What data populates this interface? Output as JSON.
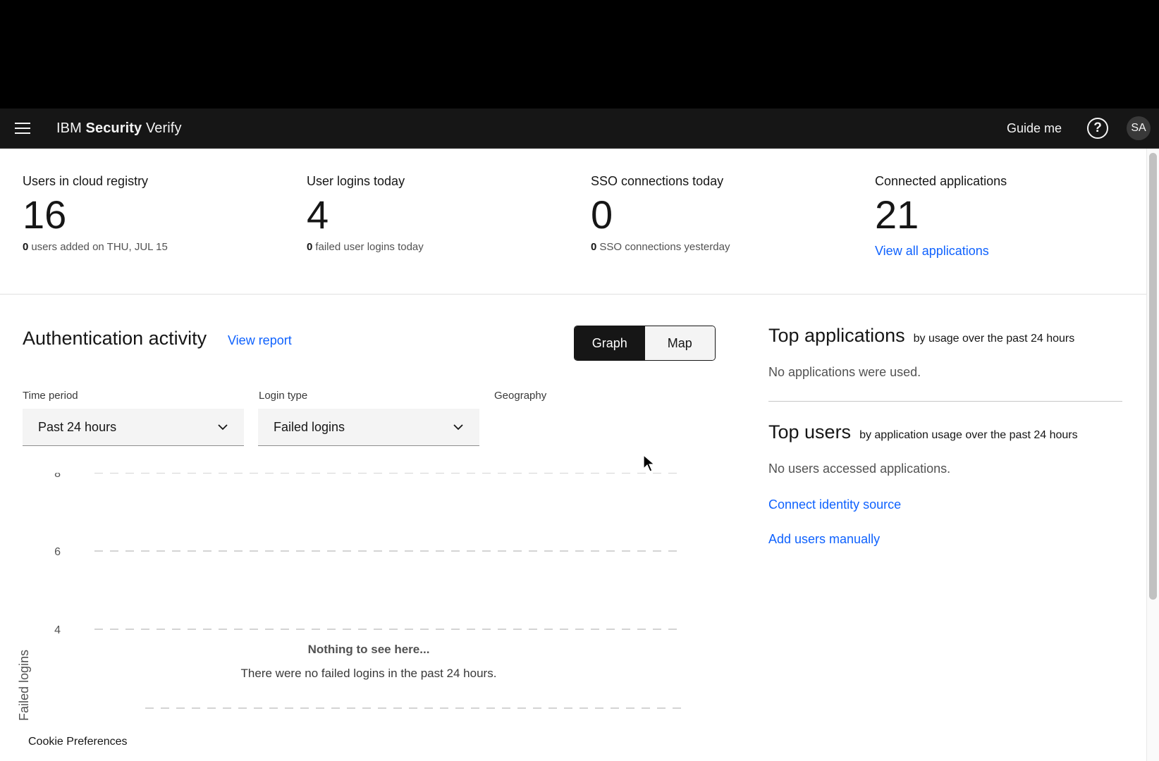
{
  "app": {
    "brand_prefix": "IBM",
    "brand_bold": "Security",
    "brand_suffix": "Verify",
    "guide_me": "Guide me",
    "help_symbol": "?",
    "avatar_initials": "SA"
  },
  "stats": [
    {
      "label": "Users in cloud registry",
      "value": "16",
      "sub_count": "0",
      "sub_text": "users added on THU, JUL 15"
    },
    {
      "label": "User logins today",
      "value": "4",
      "sub_count": "0",
      "sub_text": "failed user logins today"
    },
    {
      "label": "SSO connections today",
      "value": "0",
      "sub_count": "0",
      "sub_text": "SSO connections yesterday"
    },
    {
      "label": "Connected applications",
      "value": "21",
      "link": "View all applications"
    }
  ],
  "auth": {
    "title": "Authentication activity",
    "view_report": "View report",
    "view_toggle": [
      "Graph",
      "Map"
    ],
    "selected_view": "Graph",
    "filters": {
      "time_period": {
        "label": "Time period",
        "value": "Past 24 hours"
      },
      "login_type": {
        "label": "Login type",
        "value": "Failed logins"
      },
      "geography": {
        "label": "Geography"
      }
    },
    "empty_title": "Nothing to see here...",
    "empty_message": "There were no failed logins in the past 24 hours."
  },
  "chart_data": {
    "type": "line",
    "ylabel": "Failed logins",
    "yticks": [
      "8",
      "6",
      "4"
    ],
    "series": []
  },
  "side": {
    "top_apps_title": "Top applications",
    "top_apps_sub": "by usage over the past 24 hours",
    "top_apps_empty": "No applications were used.",
    "top_users_title": "Top users",
    "top_users_sub": "by application usage over the past 24 hours",
    "top_users_empty": "No users accessed applications.",
    "connect_identity": "Connect identity source",
    "add_users": "Add users manually"
  },
  "footer": {
    "cookie": "Cookie Preferences"
  },
  "colors": {
    "link": "#0f62fe",
    "header_bg": "#161616",
    "ui_bg": "#f4f4f4"
  },
  "icons": [
    "menu-icon",
    "help-icon",
    "chevron-down-icon",
    "mouse-pointer-icon"
  ]
}
